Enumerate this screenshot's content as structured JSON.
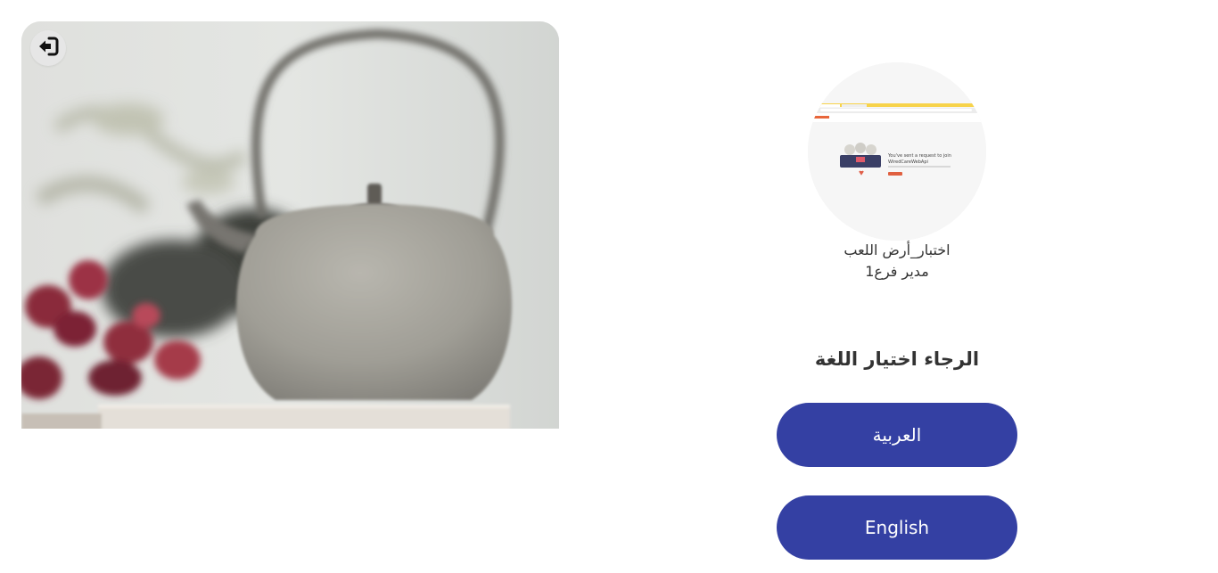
{
  "header": {
    "logout_icon": "sign-out-icon"
  },
  "profile": {
    "name": "اختبار_أرض اللعب",
    "role": "مدير فرع1",
    "avatar": {
      "headline": "You've sent a request to join",
      "subline": "WiredCareWebApi"
    }
  },
  "language": {
    "prompt": "الرجاء اختيار اللغة",
    "options": [
      {
        "label": "العربية"
      },
      {
        "label": "English"
      }
    ]
  },
  "colors": {
    "button": "#3440a3",
    "button_text": "#ffffff",
    "text": "#333333"
  }
}
